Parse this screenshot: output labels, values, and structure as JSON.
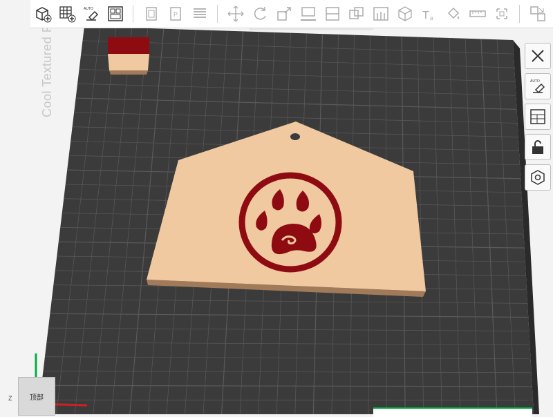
{
  "toolbar": {
    "tools": [
      "add-object-icon",
      "add-plate-icon",
      "auto-orient-icon",
      "arrange-icon",
      "split-objects-icon",
      "split-parts-icon",
      "variable-layer-icon",
      "move-icon",
      "rotate-icon",
      "scale-icon",
      "lay-on-face-icon",
      "cut-icon",
      "boolean-icon",
      "support-paint-icon",
      "seam-paint-icon",
      "text-icon",
      "color-paint-icon",
      "measure-icon",
      "assembly-icon",
      "explode-view-icon"
    ]
  },
  "plate": {
    "label": "Cool Textured PEI Plate",
    "plate_color": "#3b3b3b",
    "grid_color": "#5a5a5a"
  },
  "model": {
    "name": "ema-plaque-paw",
    "base_color": "#f0c9a0",
    "emblem_color": "#8e0b12",
    "side_color": "#a17a5a"
  },
  "filament_swatch": {
    "top_color": "#8e0b12",
    "bottom_color": "#f0c9a0"
  },
  "right_panel": {
    "buttons": [
      "close-icon",
      "auto-orient-icon",
      "arrange-icon",
      "lock-icon",
      "hexagon-icon"
    ]
  },
  "view_cube": {
    "label": "顶部"
  },
  "axis_label": "Z"
}
